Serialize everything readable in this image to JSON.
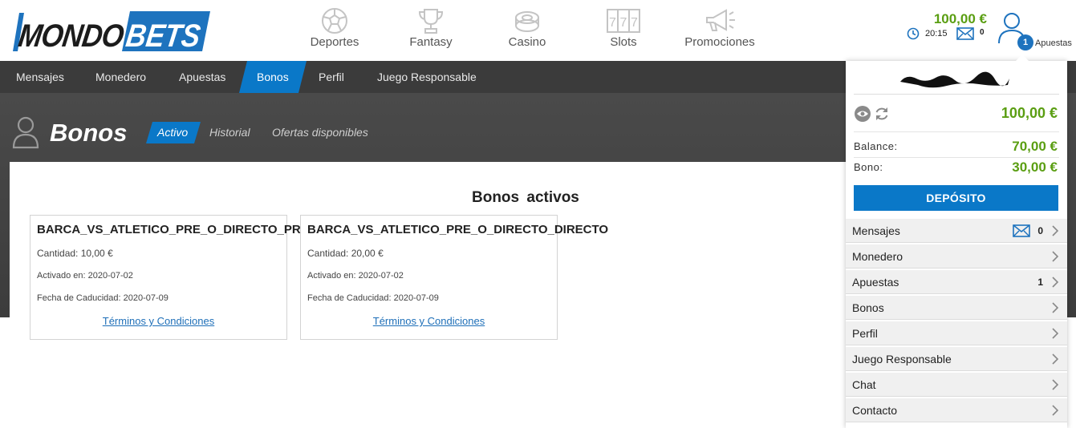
{
  "header": {
    "logo_text": "MONDOBETS",
    "nav": [
      {
        "label": "Deportes",
        "icon": "soccer-ball-icon"
      },
      {
        "label": "Fantasy",
        "icon": "trophy-icon"
      },
      {
        "label": "Casino",
        "icon": "casino-chip-icon"
      },
      {
        "label": "Slots",
        "icon": "slot-777-icon"
      },
      {
        "label": "Promociones",
        "icon": "megaphone-icon"
      }
    ],
    "balance": "100,00 €",
    "time": "20:15",
    "messages_count": "0",
    "bets_badge": "1",
    "bets_label": "Apuestas"
  },
  "subnav": {
    "items": [
      "Mensajes",
      "Monedero",
      "Apuestas",
      "Bonos",
      "Perfil",
      "Juego Responsable"
    ],
    "active": "Bonos"
  },
  "page": {
    "title": "Bonos",
    "tabs": [
      "Activo",
      "Historial",
      "Ofertas disponibles"
    ],
    "active_tab": "Activo",
    "section_title": "Bonos  activos"
  },
  "bonuses": [
    {
      "name": "BARCA_VS_ATLETICO_PRE_O_DIRECTO_PRE",
      "amount": "Cantidad: 10,00 €",
      "activated": "Activado en: 2020-07-02",
      "expires": "Fecha de Caducidad: 2020-07-09",
      "terms": "Términos y Condiciones"
    },
    {
      "name": "BARCA_VS_ATLETICO_PRE_O_DIRECTO_DIRECTO",
      "amount": "Cantidad: 20,00 €",
      "activated": "Activado en: 2020-07-02",
      "expires": "Fecha de Caducidad: 2020-07-09",
      "terms": "Términos y Condiciones"
    }
  ],
  "account_panel": {
    "total": "100,00 €",
    "balance_label": "Balance:",
    "balance_value": "70,00 €",
    "bonus_label": "Bono:",
    "bonus_value": "30,00 €",
    "deposit_label": "DEPÓSITO",
    "menu": [
      {
        "label": "Mensajes",
        "count": "0",
        "icon": "mail-icon"
      },
      {
        "label": "Monedero",
        "count": ""
      },
      {
        "label": "Apuestas",
        "count": "1"
      },
      {
        "label": "Bonos",
        "count": ""
      },
      {
        "label": "Perfil",
        "count": ""
      },
      {
        "label": "Juego Responsable",
        "count": ""
      },
      {
        "label": "Chat",
        "count": ""
      },
      {
        "label": "Contacto",
        "count": ""
      }
    ]
  },
  "colors": {
    "brand_blue": "#0a78c8",
    "money_green": "#5a9e12",
    "dark_band": "#3b3b3b",
    "logo_blue": "#1e73be"
  }
}
